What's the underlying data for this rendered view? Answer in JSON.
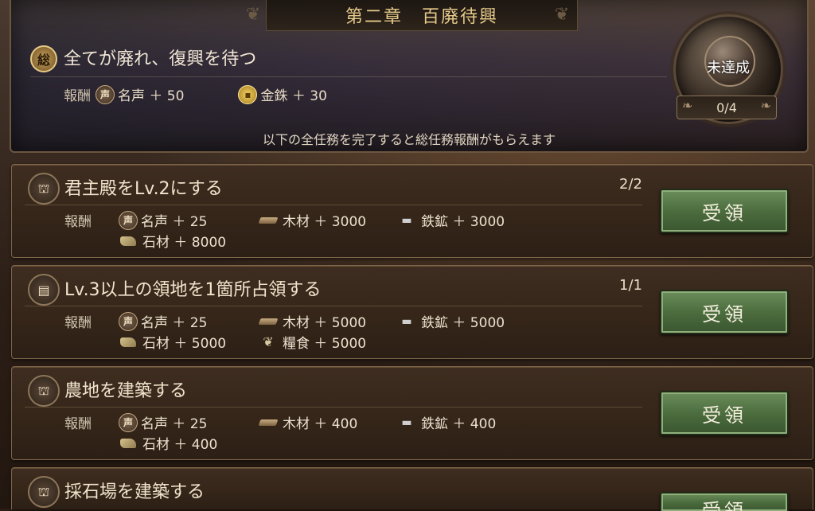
{
  "header": {
    "chapter": "第二章　百廃待興",
    "badge": "総",
    "title": "全てが廃れ、復興を待つ",
    "reward_label": "報酬",
    "rewards": [
      {
        "icon": "voice-icon",
        "glyph": "声",
        "text": "名声 ＋ 50"
      },
      {
        "icon": "gold-coin-icon",
        "glyph": "",
        "text": "金銖 ＋ 30"
      }
    ],
    "note": "以下の全任務を完了すると総任務報酬がもらえます",
    "status": "未達成",
    "progress": "0/4"
  },
  "colors": {
    "claim_button": "#4c6d3e",
    "title_gold": "#e6c98a"
  },
  "tasks": [
    {
      "icon": "castle-icon",
      "glyph": "⛫",
      "title": "君主殿をLv.2にする",
      "progress": "2/2",
      "reward_label": "報酬",
      "rewards": [
        {
          "icon": "voice-icon",
          "glyph": "声",
          "text": "名声 ＋ 25"
        },
        {
          "icon": "wood-icon",
          "glyph": "",
          "text": "木材 ＋ 3000"
        },
        {
          "icon": "iron-anvil-icon",
          "glyph": "▬",
          "text": "鉄鉱 ＋ 3000"
        },
        {
          "icon": "stone-icon",
          "glyph": "",
          "text": "石材 ＋ 8000"
        }
      ],
      "button": "受領"
    },
    {
      "icon": "book-icon",
      "glyph": "▤",
      "title": "Lv.3以上の領地を1箇所占領する",
      "progress": "1/1",
      "reward_label": "報酬",
      "rewards": [
        {
          "icon": "voice-icon",
          "glyph": "声",
          "text": "名声 ＋ 25"
        },
        {
          "icon": "wood-icon",
          "glyph": "",
          "text": "木材 ＋ 5000"
        },
        {
          "icon": "iron-anvil-icon",
          "glyph": "▬",
          "text": "鉄鉱 ＋ 5000"
        },
        {
          "icon": "stone-icon",
          "glyph": "",
          "text": "石材 ＋ 5000"
        },
        {
          "icon": "grain-icon",
          "glyph": "❦",
          "text": "糧食 ＋ 5000"
        }
      ],
      "button": "受領"
    },
    {
      "icon": "castle-icon",
      "glyph": "⛫",
      "title": "農地を建築する",
      "progress": "",
      "reward_label": "報酬",
      "rewards": [
        {
          "icon": "voice-icon",
          "glyph": "声",
          "text": "名声 ＋ 25"
        },
        {
          "icon": "wood-icon",
          "glyph": "",
          "text": "木材 ＋ 400"
        },
        {
          "icon": "iron-anvil-icon",
          "glyph": "▬",
          "text": "鉄鉱 ＋ 400"
        },
        {
          "icon": "stone-icon",
          "glyph": "",
          "text": "石材 ＋ 400"
        }
      ],
      "button": "受領"
    },
    {
      "icon": "castle-icon",
      "glyph": "⛫",
      "title": "採石場を建築する",
      "progress": "",
      "reward_label": "",
      "rewards": [],
      "button": "受領"
    }
  ]
}
